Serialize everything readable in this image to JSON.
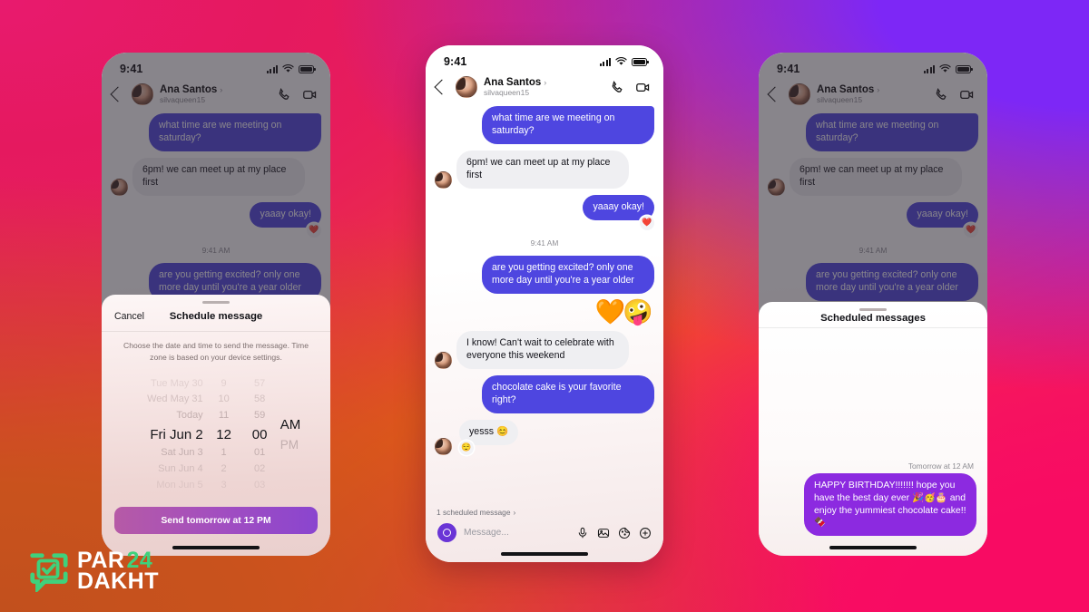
{
  "background": {
    "gradient_colors": [
      "#e8216d",
      "#7d27f6",
      "#ef5a1b",
      "#f80b63"
    ]
  },
  "brand": {
    "logo_part1": "PAR",
    "logo_part2": "24",
    "logo_part3": "DAKHT",
    "logo_green": "#3fd17c",
    "logo_white": "#ffffff"
  },
  "status_bar": {
    "time": "9:41",
    "signal_icon": "cellular-signal-icon",
    "wifi_icon": "wifi-icon",
    "battery_icon": "battery-icon"
  },
  "chat_header": {
    "back_icon": "back-chevron-icon",
    "name": "Ana Santos",
    "name_chevron": "›",
    "username": "silvaqueen15",
    "call_icon": "phone-call-icon",
    "video_icon": "video-camera-icon"
  },
  "conversation": {
    "messages": [
      {
        "side": "out",
        "text": "what time are we meeting on saturday?"
      },
      {
        "side": "in",
        "text": "6pm! we can meet up at my place first"
      },
      {
        "side": "out",
        "text": "yaaay okay!",
        "reaction": "❤️"
      },
      {
        "side": "out",
        "text": "are you getting excited? only one more day until you're a year older"
      },
      {
        "side": "sticker",
        "text": "🧡🤪"
      },
      {
        "side": "in",
        "text": "I know! Can't wait to celebrate with everyone this weekend"
      },
      {
        "side": "out",
        "text": "chocolate cake is your favorite right?"
      },
      {
        "side": "in",
        "text": "yesss 😊",
        "reaction": "😌"
      }
    ],
    "timestamp": "9:41 AM"
  },
  "composer": {
    "scheduled_strip": "1 scheduled message",
    "scheduled_strip_chevron": "›",
    "camera_icon": "camera-icon",
    "placeholder": "Message...",
    "mic_icon": "microphone-icon",
    "gallery_icon": "image-gallery-icon",
    "sticker_icon": "sticker-icon",
    "plus_icon": "plus-circle-icon"
  },
  "schedule_sheet": {
    "grabber": "sheet-grabber",
    "cancel_label": "Cancel",
    "title": "Schedule message",
    "description": "Choose the date and time to send the message. Time zone is based on your device settings.",
    "picker": {
      "dates": [
        "Tue May 30",
        "Wed May 31",
        "Today",
        "Fri Jun 2",
        "Sat Jun 3",
        "Sun Jun 4",
        "Mon Jun 5"
      ],
      "selected_date": "Fri Jun 2",
      "hours": [
        "9",
        "10",
        "11",
        "12",
        "1",
        "2",
        "3"
      ],
      "selected_hour": "12",
      "minutes": [
        "57",
        "58",
        "59",
        "00",
        "01",
        "02",
        "03"
      ],
      "selected_minute": "00",
      "meridiem": [
        "AM",
        "PM"
      ],
      "selected_meridiem": "AM"
    },
    "send_button_label": "Send tomorrow at 12 PM",
    "send_button_color": "#a24ec0"
  },
  "scheduled_list_sheet": {
    "grabber": "sheet-grabber",
    "title": "Scheduled messages",
    "item_timestamp": "Tomorrow at 12 AM",
    "item_text": "HAPPY BIRTHDAY!!!!!!! hope you have the best day ever 🎉🥳🎂 and enjoy the yummiest chocolate cake!!🍫",
    "item_color": "#8c2ae0"
  },
  "colors": {
    "sent_bubble": "#4e46e0",
    "received_bubble": "#efeff2",
    "scheduled_bubble": "#8c2ae0"
  }
}
